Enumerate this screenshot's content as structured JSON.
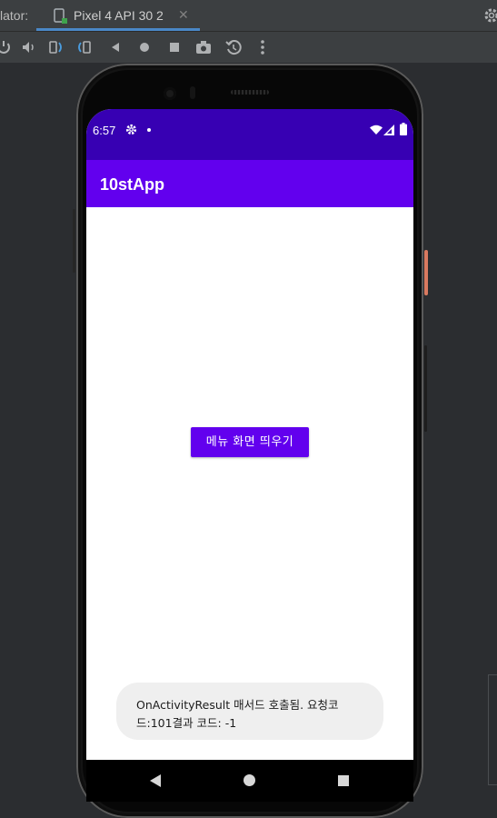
{
  "ide": {
    "panel_label": "lator:",
    "tab_title": "Pixel 4 API 30 2",
    "tab_close": "✕",
    "toolbar_icons": [
      "power-icon",
      "volume-up-icon",
      "volume-down-icon",
      "rotate-left-icon",
      "rotate-right-icon",
      "back-icon",
      "home-icon",
      "overview-icon",
      "screenshot-icon",
      "snapshot-icon",
      "more-icon"
    ]
  },
  "device": {
    "status_bar": {
      "time": "6:57"
    },
    "app_bar": {
      "title": "10stApp"
    },
    "content": {
      "button_label": "메뉴 화면 띄우기"
    },
    "toast": {
      "line1": "OnActivityResult 매서드 호출됨. 요청코",
      "line2": "드:101결과 코드: -1"
    }
  },
  "colors": {
    "status_bar": "#3700b3",
    "primary": "#6200ee",
    "toast_bg": "#efefef",
    "ide_bg": "#2b2d30",
    "ide_tab_accent": "#4a88c7",
    "power_button": "#d97a60"
  }
}
